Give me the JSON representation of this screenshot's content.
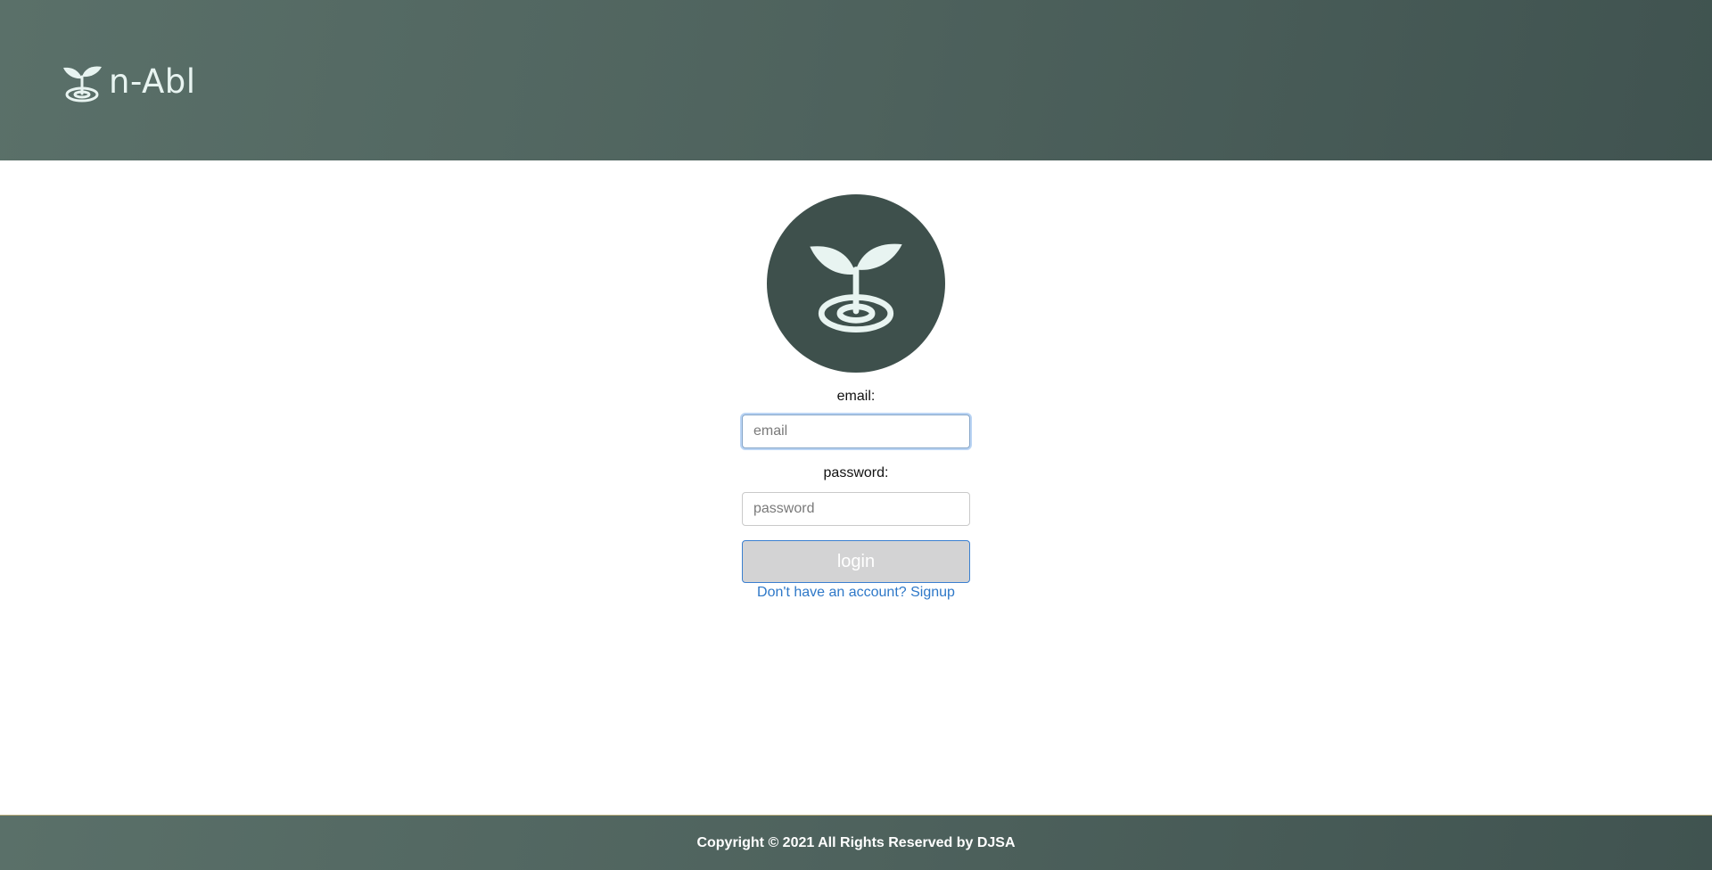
{
  "header": {
    "brand_name": "n-Abl",
    "logo_icon": "sprout-icon"
  },
  "login": {
    "avatar_icon": "sprout-icon",
    "email_label": "email:",
    "email_placeholder": "email",
    "password_label": "password:",
    "password_placeholder": "password",
    "login_label": "login",
    "signup_link": "Don't have an account? Signup"
  },
  "footer": {
    "copyright": "Copyright © 2021 All Rights Reserved by DJSA"
  },
  "colors": {
    "header_bg": "#4e625d",
    "avatar_bg": "#3e504c",
    "link": "#2e78c8",
    "button_bg": "#d3d3d4",
    "button_border": "#3a7fd0"
  }
}
